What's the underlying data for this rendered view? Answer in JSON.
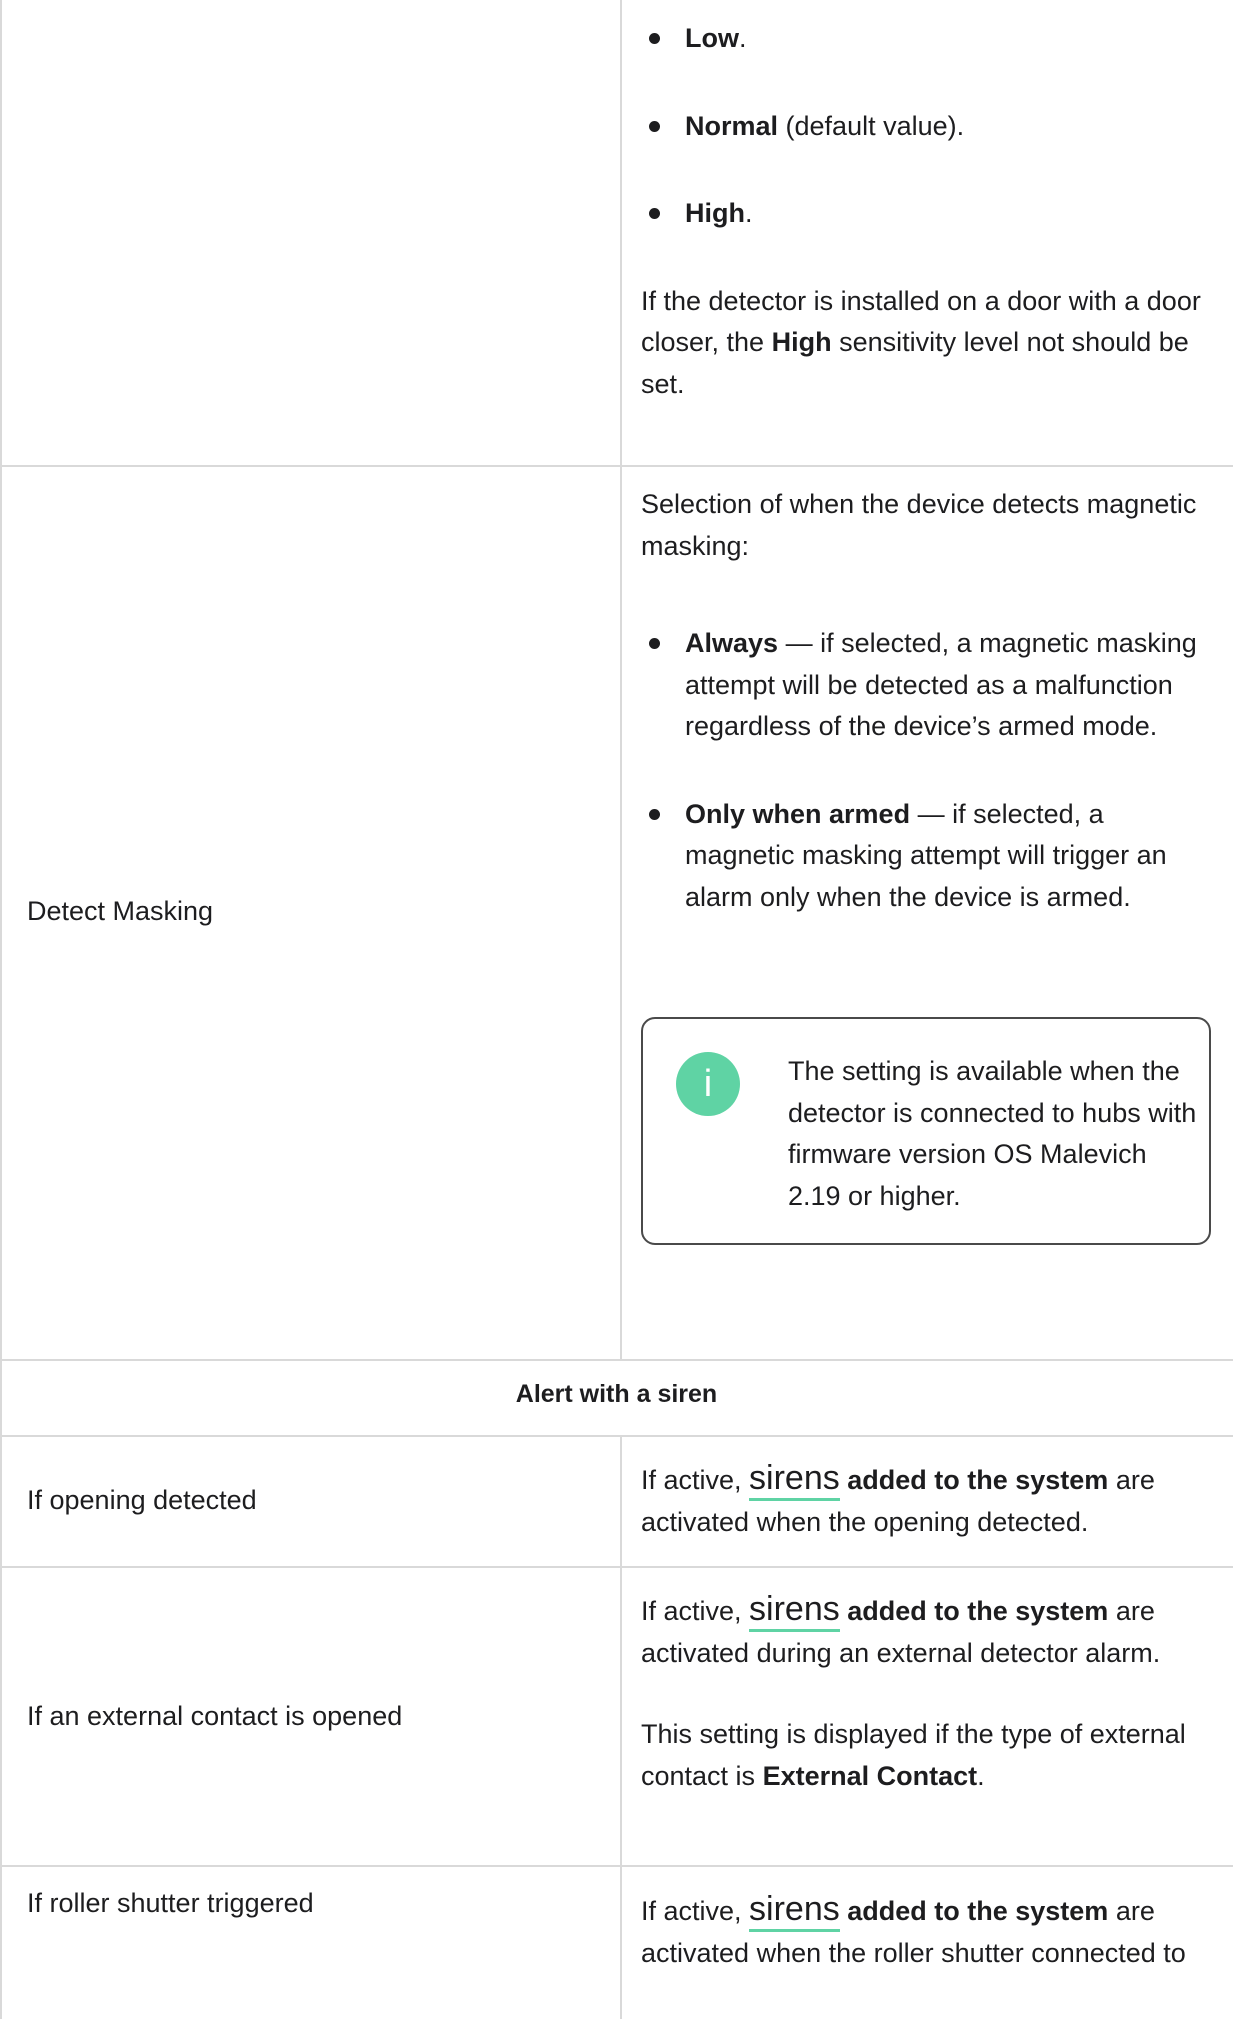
{
  "sensitivity_row": {
    "options": [
      {
        "label": "Low",
        "suffix": "."
      },
      {
        "label": "Normal",
        "suffix": " (default value)."
      },
      {
        "label": "High",
        "suffix": "."
      }
    ],
    "note_part1": "If the detector is installed on a door with a door closer, the ",
    "note_bold": "High",
    "note_part2": " sensitivity level not should be set."
  },
  "detect_masking_row": {
    "name": "Detect Masking",
    "intro": "Selection of when the device detects magnetic masking:",
    "options": [
      {
        "label": "Always",
        "desc": " — if selected, a magnetic masking attempt will be detected as a malfunction regardless of the device’s armed mode."
      },
      {
        "label": "Only when armed",
        "desc": " — if selected, a magnetic masking attempt will trigger an alarm only when the device is armed."
      }
    ],
    "info_icon_glyph": "i",
    "info_text": "The setting is available when the detector is connected to hubs with firmware version OS Malevich 2.19 or higher."
  },
  "section_header": "Alert with a siren",
  "siren_rows": [
    {
      "name": "If opening detected",
      "prefix": "If active, ",
      "link": "sirens",
      "bold": " added to the system",
      "suffix": " are activated when the opening detected.",
      "note_part1": "",
      "note_bold": "",
      "note_part2": ""
    },
    {
      "name": "If an external contact is opened",
      "prefix": "If active, ",
      "link": "sirens",
      "bold": " added to the system",
      "suffix": " are activated during an external detector alarm.",
      "note_part1": "This setting is displayed if the type of external contact is ",
      "note_bold": "External Contact",
      "note_part2": "."
    },
    {
      "name": "If roller shutter triggered",
      "prefix": "If active, ",
      "link": "sirens",
      "bold": " added to the system",
      "suffix": " are activated when the roller shutter connected to",
      "note_part1": "",
      "note_bold": "",
      "note_part2": ""
    }
  ],
  "colors": {
    "accent": "#5fd3a4",
    "border": "#d9d9d9",
    "text": "#1d1d1f"
  }
}
